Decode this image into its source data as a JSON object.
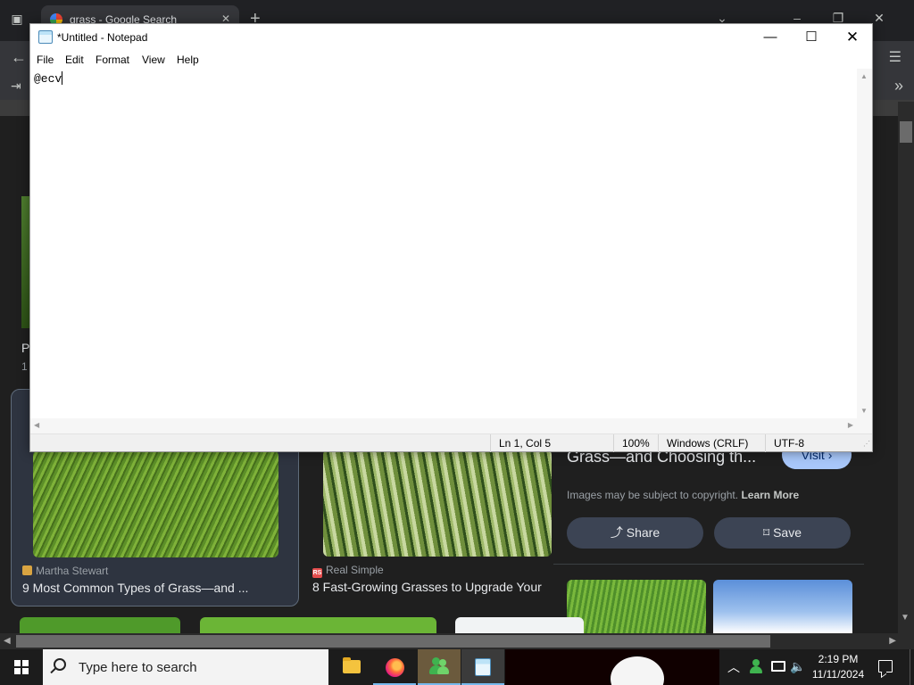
{
  "browser": {
    "tab_title": "grass - Google Search",
    "tab_close": "✕",
    "new_tab": "+",
    "icons": {
      "tab_list": "▣",
      "back": "←",
      "sign_in": "⇥",
      "menu": "☰",
      "more": "»",
      "chevron": "⌄",
      "minimize": "–",
      "restore": "❐",
      "close": "✕"
    }
  },
  "page": {
    "left_fragment": {
      "title": "P",
      "sub": "1"
    },
    "results": [
      {
        "source": "Martha Stewart",
        "title": "9 Most Common Types of Grass—and ..."
      },
      {
        "source": "Real Simple",
        "source_badge": "RS",
        "title": "8 Fast-Growing Grasses to Upgrade Your"
      }
    ],
    "preview": {
      "title": "Grass—and Choosing th...",
      "visit": "Visit ›",
      "copyright": "Images may be subject to copyright.",
      "learn_more": "Learn More",
      "share": "Share",
      "save": "Save"
    }
  },
  "notepad": {
    "title": "*Untitled - Notepad",
    "controls": {
      "minimize": "—",
      "maximize": "☐",
      "close": "✕"
    },
    "menu": [
      "File",
      "Edit",
      "Format",
      "View",
      "Help"
    ],
    "content": "@ecv",
    "status": {
      "position": "Ln 1, Col 5",
      "zoom": "100%",
      "line_ending": "Windows (CRLF)",
      "encoding": "UTF-8"
    }
  },
  "taskbar": {
    "search_placeholder": "Type here to search",
    "apps": [
      "file-explorer",
      "firefox",
      "people",
      "notepad"
    ],
    "tray_chevron": "︿",
    "volume": "🔈",
    "time": "2:19 PM",
    "date": "11/11/2024"
  },
  "colors": {
    "browser_bg": "#1f1f1f",
    "taskbar_bg": "#1c1c1c",
    "visit_button": "#a8c7fa",
    "action_button": "#3c4454"
  }
}
